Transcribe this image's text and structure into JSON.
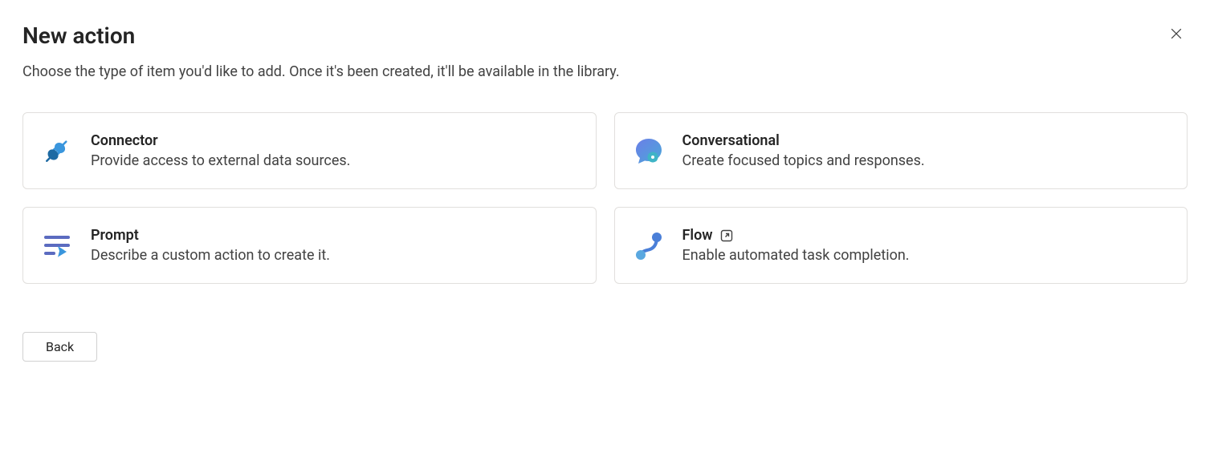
{
  "header": {
    "title": "New action",
    "subtitle": "Choose the type of item you'd like to add. Once it's been created, it'll be available in the library."
  },
  "cards": {
    "connector": {
      "title": "Connector",
      "description": "Provide access to external data sources."
    },
    "conversational": {
      "title": "Conversational",
      "description": "Create focused topics and responses."
    },
    "prompt": {
      "title": "Prompt",
      "description": "Describe a custom action to create it."
    },
    "flow": {
      "title": "Flow",
      "description": "Enable automated task completion."
    }
  },
  "footer": {
    "back_label": "Back"
  }
}
